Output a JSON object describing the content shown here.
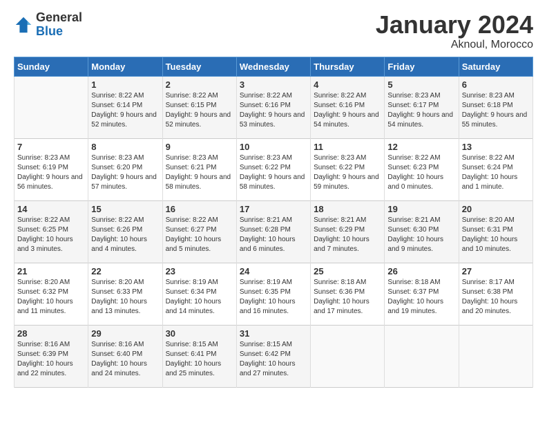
{
  "header": {
    "logo_general": "General",
    "logo_blue": "Blue",
    "title": "January 2024",
    "subtitle": "Aknoul, Morocco"
  },
  "days_of_week": [
    "Sunday",
    "Monday",
    "Tuesday",
    "Wednesday",
    "Thursday",
    "Friday",
    "Saturday"
  ],
  "weeks": [
    [
      {
        "day": "",
        "sunrise": "",
        "sunset": "",
        "daylight": ""
      },
      {
        "day": "1",
        "sunrise": "Sunrise: 8:22 AM",
        "sunset": "Sunset: 6:14 PM",
        "daylight": "Daylight: 9 hours and 52 minutes."
      },
      {
        "day": "2",
        "sunrise": "Sunrise: 8:22 AM",
        "sunset": "Sunset: 6:15 PM",
        "daylight": "Daylight: 9 hours and 52 minutes."
      },
      {
        "day": "3",
        "sunrise": "Sunrise: 8:22 AM",
        "sunset": "Sunset: 6:16 PM",
        "daylight": "Daylight: 9 hours and 53 minutes."
      },
      {
        "day": "4",
        "sunrise": "Sunrise: 8:22 AM",
        "sunset": "Sunset: 6:16 PM",
        "daylight": "Daylight: 9 hours and 54 minutes."
      },
      {
        "day": "5",
        "sunrise": "Sunrise: 8:23 AM",
        "sunset": "Sunset: 6:17 PM",
        "daylight": "Daylight: 9 hours and 54 minutes."
      },
      {
        "day": "6",
        "sunrise": "Sunrise: 8:23 AM",
        "sunset": "Sunset: 6:18 PM",
        "daylight": "Daylight: 9 hours and 55 minutes."
      }
    ],
    [
      {
        "day": "7",
        "sunrise": "Sunrise: 8:23 AM",
        "sunset": "Sunset: 6:19 PM",
        "daylight": "Daylight: 9 hours and 56 minutes."
      },
      {
        "day": "8",
        "sunrise": "Sunrise: 8:23 AM",
        "sunset": "Sunset: 6:20 PM",
        "daylight": "Daylight: 9 hours and 57 minutes."
      },
      {
        "day": "9",
        "sunrise": "Sunrise: 8:23 AM",
        "sunset": "Sunset: 6:21 PM",
        "daylight": "Daylight: 9 hours and 58 minutes."
      },
      {
        "day": "10",
        "sunrise": "Sunrise: 8:23 AM",
        "sunset": "Sunset: 6:22 PM",
        "daylight": "Daylight: 9 hours and 58 minutes."
      },
      {
        "day": "11",
        "sunrise": "Sunrise: 8:23 AM",
        "sunset": "Sunset: 6:22 PM",
        "daylight": "Daylight: 9 hours and 59 minutes."
      },
      {
        "day": "12",
        "sunrise": "Sunrise: 8:22 AM",
        "sunset": "Sunset: 6:23 PM",
        "daylight": "Daylight: 10 hours and 0 minutes."
      },
      {
        "day": "13",
        "sunrise": "Sunrise: 8:22 AM",
        "sunset": "Sunset: 6:24 PM",
        "daylight": "Daylight: 10 hours and 1 minute."
      }
    ],
    [
      {
        "day": "14",
        "sunrise": "Sunrise: 8:22 AM",
        "sunset": "Sunset: 6:25 PM",
        "daylight": "Daylight: 10 hours and 3 minutes."
      },
      {
        "day": "15",
        "sunrise": "Sunrise: 8:22 AM",
        "sunset": "Sunset: 6:26 PM",
        "daylight": "Daylight: 10 hours and 4 minutes."
      },
      {
        "day": "16",
        "sunrise": "Sunrise: 8:22 AM",
        "sunset": "Sunset: 6:27 PM",
        "daylight": "Daylight: 10 hours and 5 minutes."
      },
      {
        "day": "17",
        "sunrise": "Sunrise: 8:21 AM",
        "sunset": "Sunset: 6:28 PM",
        "daylight": "Daylight: 10 hours and 6 minutes."
      },
      {
        "day": "18",
        "sunrise": "Sunrise: 8:21 AM",
        "sunset": "Sunset: 6:29 PM",
        "daylight": "Daylight: 10 hours and 7 minutes."
      },
      {
        "day": "19",
        "sunrise": "Sunrise: 8:21 AM",
        "sunset": "Sunset: 6:30 PM",
        "daylight": "Daylight: 10 hours and 9 minutes."
      },
      {
        "day": "20",
        "sunrise": "Sunrise: 8:20 AM",
        "sunset": "Sunset: 6:31 PM",
        "daylight": "Daylight: 10 hours and 10 minutes."
      }
    ],
    [
      {
        "day": "21",
        "sunrise": "Sunrise: 8:20 AM",
        "sunset": "Sunset: 6:32 PM",
        "daylight": "Daylight: 10 hours and 11 minutes."
      },
      {
        "day": "22",
        "sunrise": "Sunrise: 8:20 AM",
        "sunset": "Sunset: 6:33 PM",
        "daylight": "Daylight: 10 hours and 13 minutes."
      },
      {
        "day": "23",
        "sunrise": "Sunrise: 8:19 AM",
        "sunset": "Sunset: 6:34 PM",
        "daylight": "Daylight: 10 hours and 14 minutes."
      },
      {
        "day": "24",
        "sunrise": "Sunrise: 8:19 AM",
        "sunset": "Sunset: 6:35 PM",
        "daylight": "Daylight: 10 hours and 16 minutes."
      },
      {
        "day": "25",
        "sunrise": "Sunrise: 8:18 AM",
        "sunset": "Sunset: 6:36 PM",
        "daylight": "Daylight: 10 hours and 17 minutes."
      },
      {
        "day": "26",
        "sunrise": "Sunrise: 8:18 AM",
        "sunset": "Sunset: 6:37 PM",
        "daylight": "Daylight: 10 hours and 19 minutes."
      },
      {
        "day": "27",
        "sunrise": "Sunrise: 8:17 AM",
        "sunset": "Sunset: 6:38 PM",
        "daylight": "Daylight: 10 hours and 20 minutes."
      }
    ],
    [
      {
        "day": "28",
        "sunrise": "Sunrise: 8:16 AM",
        "sunset": "Sunset: 6:39 PM",
        "daylight": "Daylight: 10 hours and 22 minutes."
      },
      {
        "day": "29",
        "sunrise": "Sunrise: 8:16 AM",
        "sunset": "Sunset: 6:40 PM",
        "daylight": "Daylight: 10 hours and 24 minutes."
      },
      {
        "day": "30",
        "sunrise": "Sunrise: 8:15 AM",
        "sunset": "Sunset: 6:41 PM",
        "daylight": "Daylight: 10 hours and 25 minutes."
      },
      {
        "day": "31",
        "sunrise": "Sunrise: 8:15 AM",
        "sunset": "Sunset: 6:42 PM",
        "daylight": "Daylight: 10 hours and 27 minutes."
      },
      {
        "day": "",
        "sunrise": "",
        "sunset": "",
        "daylight": ""
      },
      {
        "day": "",
        "sunrise": "",
        "sunset": "",
        "daylight": ""
      },
      {
        "day": "",
        "sunrise": "",
        "sunset": "",
        "daylight": ""
      }
    ]
  ]
}
